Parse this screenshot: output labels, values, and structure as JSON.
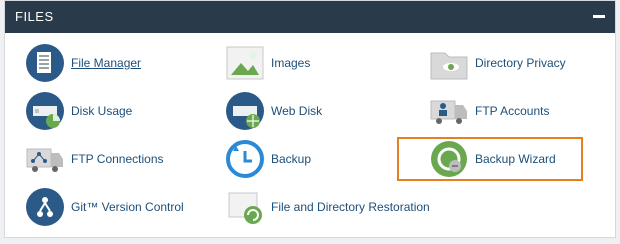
{
  "panel": {
    "title": "FILES"
  },
  "items": {
    "file_manager": "File Manager",
    "images": "Images",
    "directory_privacy": "Directory Privacy",
    "disk_usage": "Disk Usage",
    "web_disk": "Web Disk",
    "ftp_accounts": "FTP Accounts",
    "ftp_connections": "FTP Connections",
    "backup": "Backup",
    "backup_wizard": "Backup Wizard",
    "git_version_control": "Git™ Version Control",
    "file_dir_restoration": "File and Directory Restoration"
  },
  "colors": {
    "header_bg": "#293a4a",
    "link": "#1d4f7a",
    "highlight": "#e67e22",
    "icon_blue": "#2b5a88",
    "icon_green": "#6aa84f"
  }
}
